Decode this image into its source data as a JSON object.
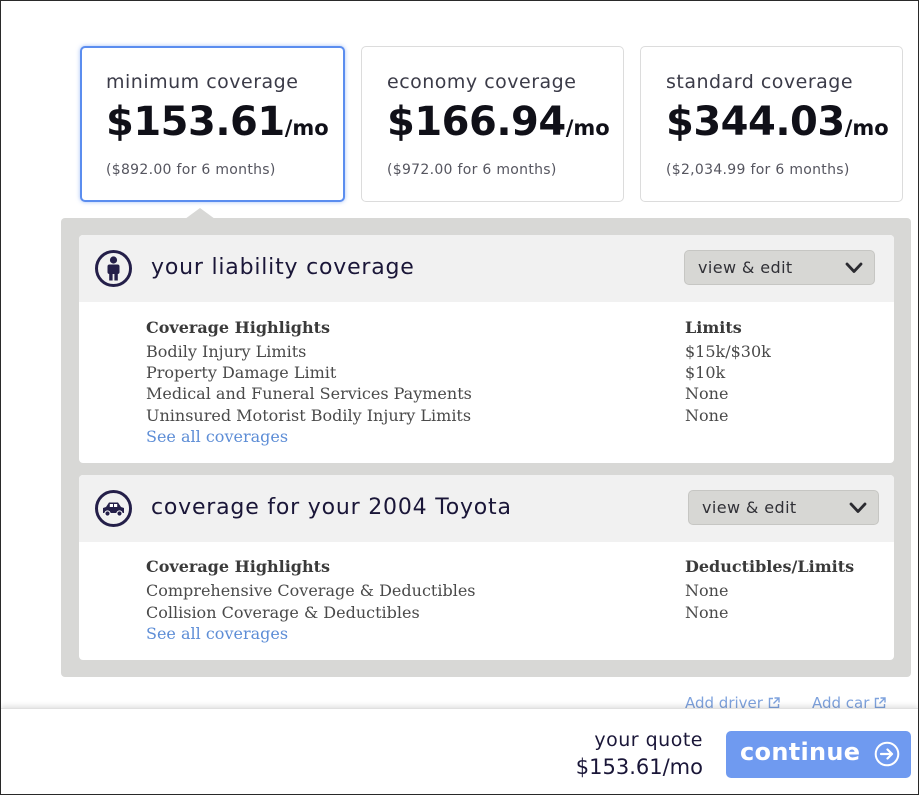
{
  "plans": [
    {
      "name": "minimum coverage",
      "price": "$153.61",
      "unit": "/mo",
      "six_month": "($892.00 for 6 months)"
    },
    {
      "name": "economy coverage",
      "price": "$166.94",
      "unit": "/mo",
      "six_month": "($972.00 for 6 months)"
    },
    {
      "name": "standard coverage",
      "price": "$344.03",
      "unit": "/mo",
      "six_month": "($2,034.99 for 6 months)"
    }
  ],
  "liability": {
    "title": "your liability coverage",
    "icon": "person-icon",
    "view_edit": "view & edit",
    "col_left": "Coverage Highlights",
    "col_right": "Limits",
    "rows": [
      {
        "name": "Bodily Injury Limits",
        "value": "$15k/$30k"
      },
      {
        "name": "Property Damage Limit",
        "value": "$10k"
      },
      {
        "name": "Medical and Funeral Services Payments",
        "value": "None"
      },
      {
        "name": "Uninsured Motorist Bodily Injury Limits",
        "value": "None"
      }
    ],
    "see_all": "See all coverages"
  },
  "vehicle": {
    "title": "coverage for your 2004 Toyota",
    "icon": "car-icon",
    "view_edit": "view & edit",
    "col_left": "Coverage Highlights",
    "col_right": "Deductibles/Limits",
    "rows": [
      {
        "name": "Comprehensive Coverage & Deductibles",
        "value": "None"
      },
      {
        "name": "Collision Coverage & Deductibles",
        "value": "None"
      }
    ],
    "see_all": "See all coverages"
  },
  "links": {
    "add_driver": "Add driver",
    "add_car": "Add car"
  },
  "footer": {
    "quote_label": "your quote",
    "quote_amount": "$153.61/mo",
    "continue_label": "continue"
  },
  "colors": {
    "accent": "#6f9af0",
    "selected_border": "#5b8def",
    "link": "#5d8dd6",
    "heading_ink": "#1a1638"
  }
}
